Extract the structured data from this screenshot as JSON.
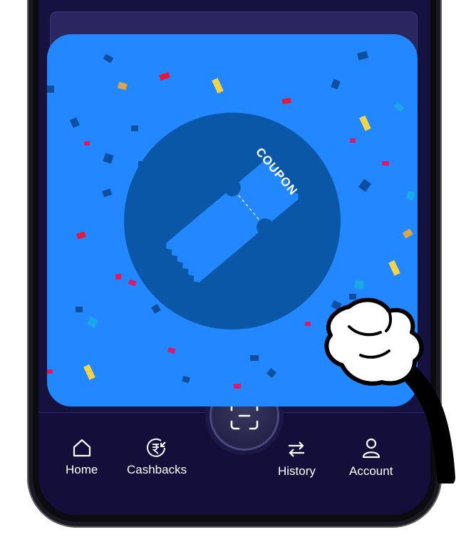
{
  "nav": {
    "items": [
      {
        "label": "Home",
        "icon": "home-icon"
      },
      {
        "label": "Cashbacks",
        "icon": "rupee-cashback-icon"
      },
      {
        "label": "History",
        "icon": "swap-arrows-icon"
      },
      {
        "label": "Account",
        "icon": "user-icon"
      }
    ],
    "scan_icon": "scan-icon"
  },
  "popup": {
    "coupon_label": "COUPON",
    "icon": "coupon-ticket-icon"
  },
  "colors": {
    "popup_bg": "#2388ff",
    "circle": "#0a57a8",
    "nav_bg": "#130f3a",
    "screen_bg": "#15123f"
  }
}
